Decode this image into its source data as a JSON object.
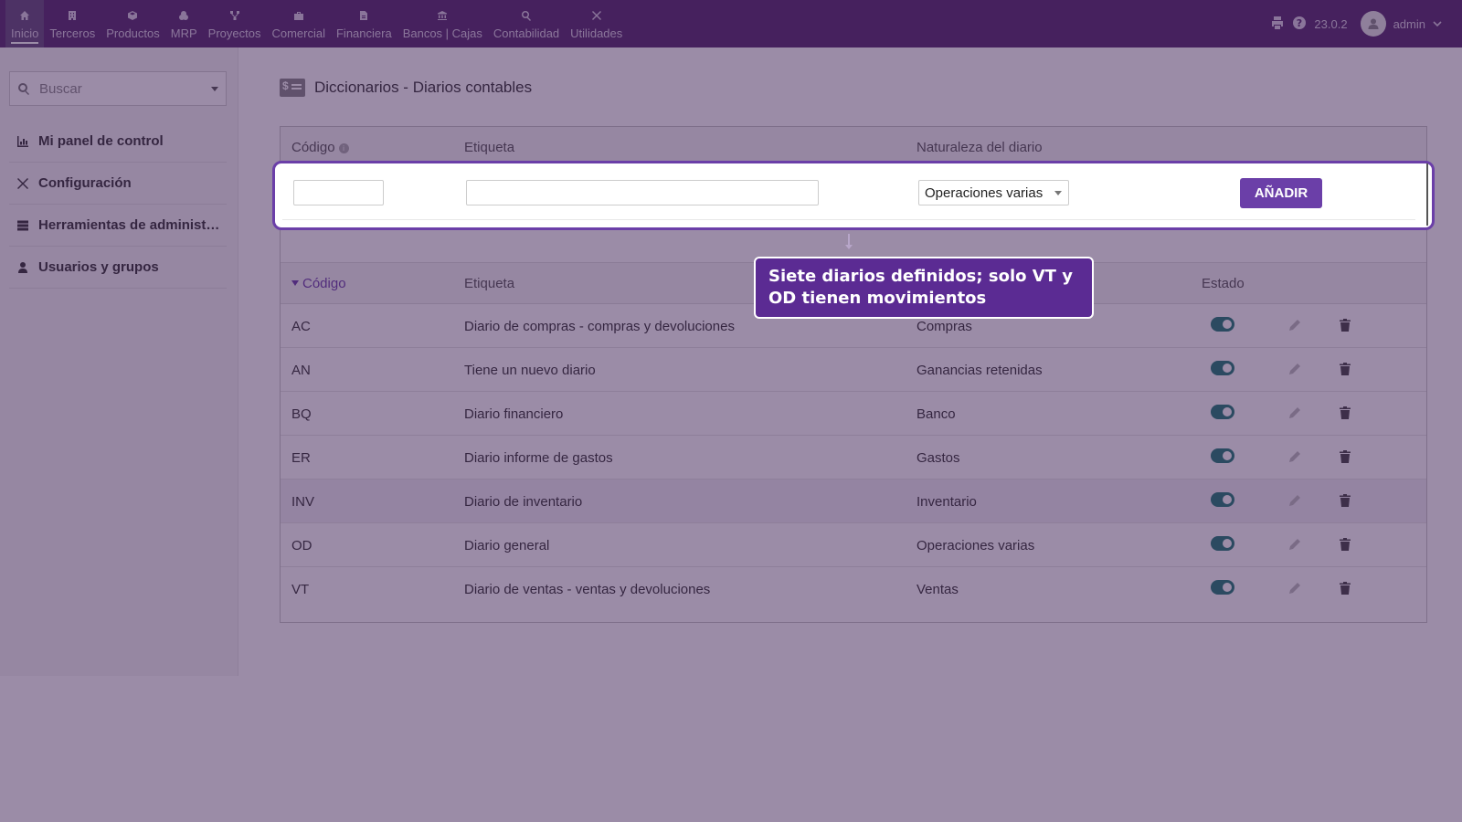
{
  "topbar": {
    "nav": [
      {
        "label": "Inicio",
        "icon": "home-icon",
        "active": true
      },
      {
        "label": "Terceros",
        "icon": "building-icon"
      },
      {
        "label": "Productos",
        "icon": "cube-icon"
      },
      {
        "label": "MRP",
        "icon": "cubes-icon"
      },
      {
        "label": "Proyectos",
        "icon": "sitemap-icon"
      },
      {
        "label": "Comercial",
        "icon": "suitcase-icon"
      },
      {
        "label": "Financiera",
        "icon": "file-invoice-icon"
      },
      {
        "label": "Bancos | Cajas",
        "icon": "bank-icon"
      },
      {
        "label": "Contabilidad",
        "icon": "search-dollar-icon"
      },
      {
        "label": "Utilidades",
        "icon": "tools-icon"
      }
    ],
    "version": "23.0.2",
    "user": "admin"
  },
  "sidebar": {
    "search_placeholder": "Buscar",
    "items": [
      {
        "label": "Mi panel de control",
        "icon": "chart-icon"
      },
      {
        "label": "Configuración",
        "icon": "tools-icon"
      },
      {
        "label": "Herramientas de administ…",
        "icon": "server-icon"
      },
      {
        "label": "Usuarios y grupos",
        "icon": "user-icon"
      }
    ]
  },
  "page": {
    "title": "Diccionarios - Diarios contables",
    "add_header": {
      "code": "Código",
      "label": "Etiqueta",
      "nature": "Naturaleza del diario"
    },
    "add_form": {
      "nature_selected": "Operaciones varias",
      "add_button": "AÑADIR"
    },
    "list_header": {
      "code": "Código",
      "label": "Etiqueta",
      "status": "Estado"
    },
    "rows": [
      {
        "code": "AC",
        "label": "Diario de compras - compras y devoluciones",
        "nature": "Compras"
      },
      {
        "code": "AN",
        "label": "Tiene un nuevo diario",
        "nature": "Ganancias retenidas"
      },
      {
        "code": "BQ",
        "label": "Diario financiero",
        "nature": "Banco"
      },
      {
        "code": "ER",
        "label": "Diario informe de gastos",
        "nature": "Gastos"
      },
      {
        "code": "INV",
        "label": "Diario de inventario",
        "nature": "Inventario"
      },
      {
        "code": "OD",
        "label": "Diario general",
        "nature": "Operaciones varias"
      },
      {
        "code": "VT",
        "label": "Diario de ventas - ventas y devoluciones",
        "nature": "Ventas"
      }
    ]
  },
  "callout": {
    "text": "Siete diarios definidos; solo VT y OD tienen movimientos"
  },
  "colors": {
    "topbar": "#54296c",
    "accent": "#6b3fa8",
    "toggle_on": "#1f7a72",
    "callout": "#5b2b93"
  }
}
